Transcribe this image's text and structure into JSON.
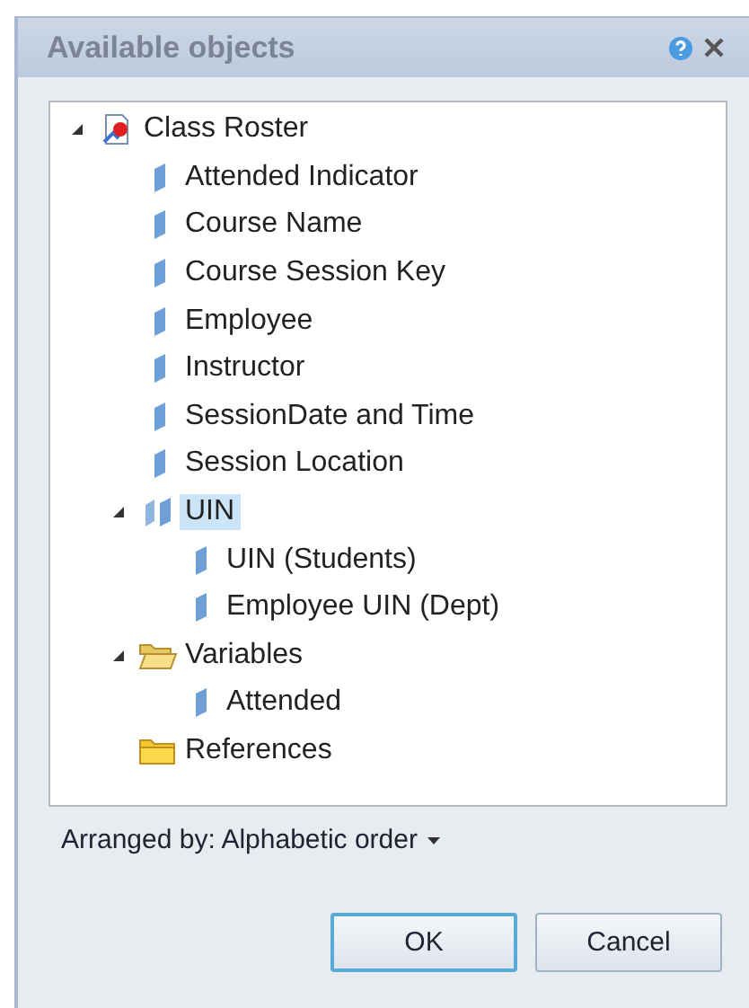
{
  "window": {
    "title": "Available objects"
  },
  "tree": [
    {
      "label": "Class Roster",
      "kind": "universe",
      "expanded": true,
      "selected": false,
      "children": [
        {
          "label": "Attended Indicator",
          "kind": "dimension",
          "selected": false
        },
        {
          "label": "Course Name",
          "kind": "dimension",
          "selected": false
        },
        {
          "label": "Course Session Key",
          "kind": "dimension",
          "selected": false
        },
        {
          "label": "Employee",
          "kind": "dimension",
          "selected": false
        },
        {
          "label": "Instructor",
          "kind": "dimension",
          "selected": false
        },
        {
          "label": "SessionDate and Time",
          "kind": "dimension",
          "selected": false
        },
        {
          "label": "Session Location",
          "kind": "dimension",
          "selected": false
        },
        {
          "label": "UIN",
          "kind": "hierarchy",
          "expanded": true,
          "selected": true,
          "children": [
            {
              "label": "UIN (Students)",
              "kind": "dimension",
              "selected": false
            },
            {
              "label": "Employee UIN (Dept)",
              "kind": "dimension",
              "selected": false
            }
          ]
        },
        {
          "label": "Variables",
          "kind": "folder",
          "expanded": true,
          "selected": false,
          "children": [
            {
              "label": "Attended",
              "kind": "dimension",
              "selected": false
            }
          ]
        },
        {
          "label": "References",
          "kind": "folder",
          "selected": false
        }
      ]
    }
  ],
  "arranged_by": "Arranged by: Alphabetic order",
  "buttons": [
    {
      "label": "OK",
      "kind": "default"
    },
    {
      "label": "Cancel",
      "kind": "normal"
    }
  ]
}
